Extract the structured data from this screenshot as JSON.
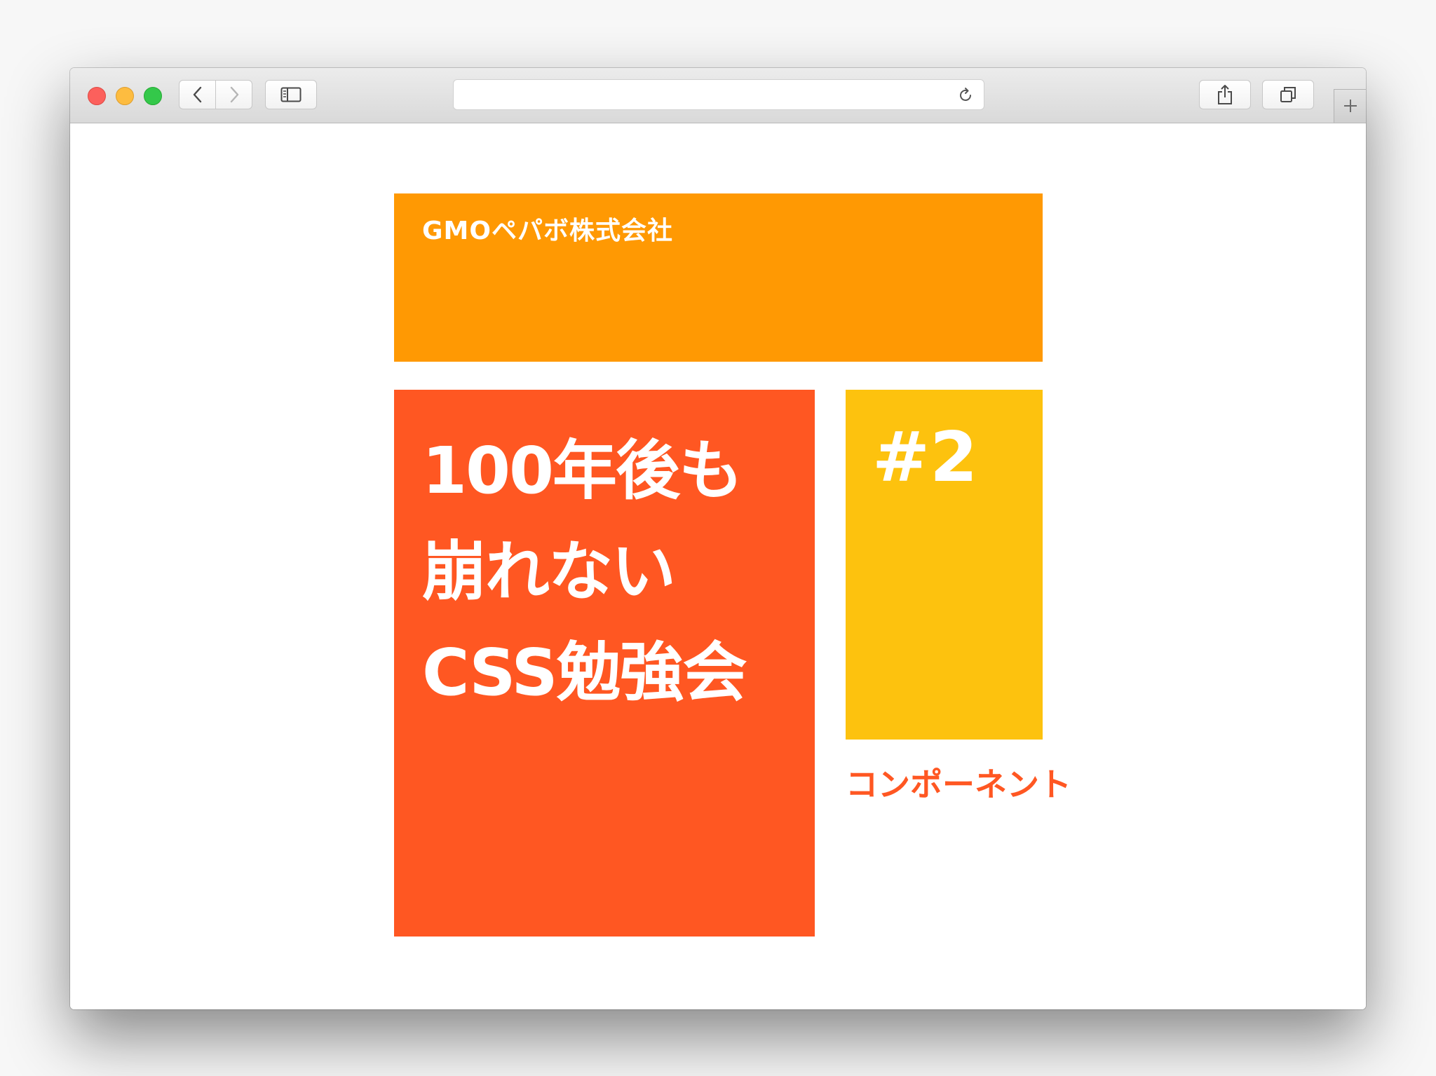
{
  "browser": {
    "address_url": "",
    "icons": {
      "back": "chevron-left-icon",
      "forward": "chevron-right-icon",
      "sidebar": "sidebar-icon",
      "reload": "reload-icon",
      "share": "share-icon",
      "tabs": "tabs-overview-icon",
      "new_tab": "plus-icon"
    }
  },
  "slide": {
    "company": "GMOペパボ株式会社",
    "title_lines": [
      "100年後も",
      "崩れない",
      "CSS勉強会"
    ],
    "number": "#2",
    "subtitle": "コンポーネント",
    "colors": {
      "header": "#ff9903",
      "title_block": "#ff5722",
      "number_block": "#fdc20e",
      "subtitle": "#ff5722"
    }
  }
}
